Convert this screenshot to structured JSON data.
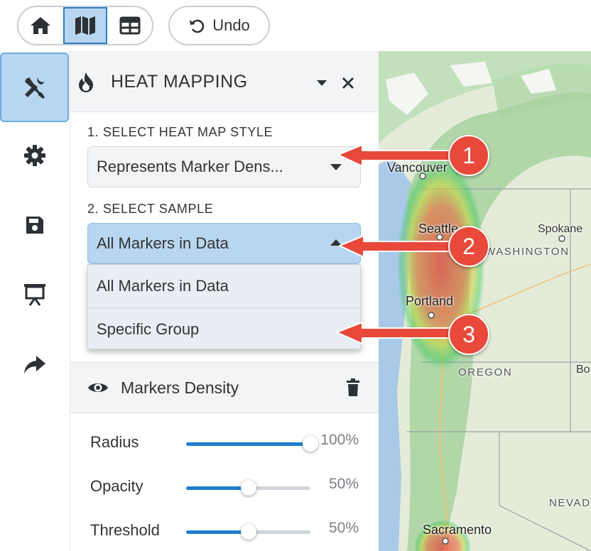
{
  "toolbar": {
    "undo_label": "Undo",
    "buttons": [
      {
        "icon": "home-icon"
      },
      {
        "icon": "map-icon",
        "active": true
      },
      {
        "icon": "table-icon"
      }
    ]
  },
  "rail": {
    "items": [
      {
        "icon": "tools-icon",
        "active": true
      },
      {
        "icon": "gear-icon"
      },
      {
        "icon": "save-icon"
      },
      {
        "icon": "presentation-icon"
      },
      {
        "icon": "share-icon"
      }
    ]
  },
  "panel": {
    "title": "HEAT MAPPING",
    "step1_label": "1. SELECT HEAT MAP STYLE",
    "style_value": "Represents Marker Dens...",
    "step2_label": "2. SELECT SAMPLE",
    "sample_value": "All Markers in Data",
    "sample_options": [
      "All Markers in Data",
      "Specific Group"
    ],
    "layer_name": "Markers Density",
    "sliders": [
      {
        "label": "Radius",
        "value": "100%",
        "fraction": 1.0
      },
      {
        "label": "Opacity",
        "value": "50%",
        "fraction": 0.5
      },
      {
        "label": "Threshold",
        "value": "50%",
        "fraction": 0.5
      }
    ]
  },
  "map": {
    "cities": [
      "Vancouver",
      "Seattle",
      "Spokane",
      "Portland",
      "Sacramento"
    ],
    "states": [
      "WASHINGTON",
      "OREGON",
      "NEVADA"
    ],
    "partial": [
      "Bo"
    ]
  },
  "annotations": [
    "1",
    "2",
    "3"
  ],
  "colors": {
    "accent": "#1f7fd0",
    "active_bg": "#b8d6ef",
    "badge": "#e8493a"
  }
}
